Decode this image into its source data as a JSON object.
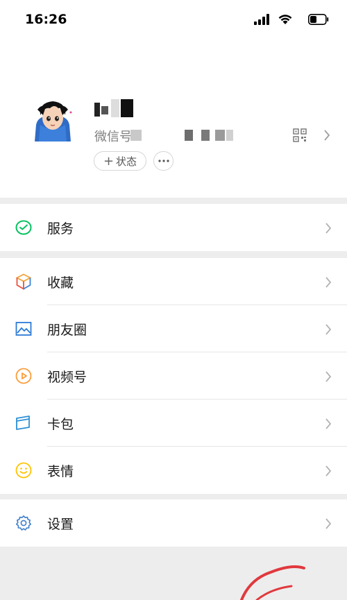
{
  "status_bar": {
    "time": "16:26"
  },
  "profile": {
    "wechat_id_label": "微信号",
    "status_button_label": "状态",
    "status_button_plus": "+",
    "more_button_label": "···"
  },
  "menu": {
    "group1": [
      {
        "label": "服务",
        "icon": "service-icon",
        "color": "#07c160"
      }
    ],
    "group2": [
      {
        "label": "收藏",
        "icon": "favorites-cube-icon",
        "color": "#f2a33a"
      },
      {
        "label": "朋友圈",
        "icon": "moments-image-icon",
        "color": "#2c7ad6"
      },
      {
        "label": "视频号",
        "icon": "channels-play-icon",
        "color": "#fa9d3b"
      },
      {
        "label": "卡包",
        "icon": "card-wallet-icon",
        "color": "#2c8fd6"
      },
      {
        "label": "表情",
        "icon": "sticker-smile-icon",
        "color": "#ffc300"
      }
    ],
    "group3": [
      {
        "label": "设置",
        "icon": "settings-gear-icon",
        "color": "#3e7ecb"
      }
    ]
  },
  "colors": {
    "background": "#ededed",
    "card": "#ffffff",
    "divider": "#e6e6e6",
    "annotation": "#e0393e"
  }
}
